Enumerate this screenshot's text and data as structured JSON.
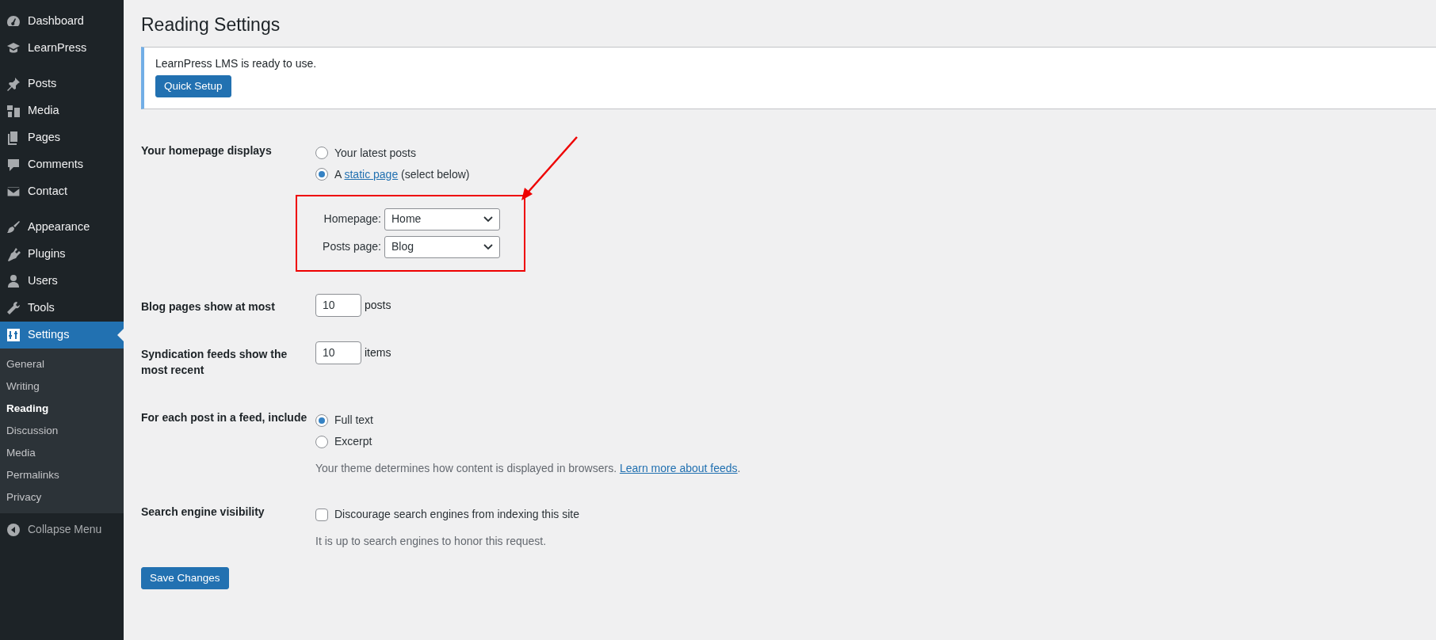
{
  "sidebar": {
    "groups": [
      [
        {
          "label": "Dashboard",
          "selected": false
        },
        {
          "label": "LearnPress",
          "selected": false
        }
      ],
      [
        {
          "label": "Posts",
          "selected": false
        },
        {
          "label": "Media",
          "selected": false
        },
        {
          "label": "Pages",
          "selected": false
        },
        {
          "label": "Comments",
          "selected": false
        },
        {
          "label": "Contact",
          "selected": false
        }
      ],
      [
        {
          "label": "Appearance",
          "selected": false
        },
        {
          "label": "Plugins",
          "selected": false
        },
        {
          "label": "Users",
          "selected": false
        },
        {
          "label": "Tools",
          "selected": false
        },
        {
          "label": "Settings",
          "selected": true,
          "children": [
            {
              "label": "General",
              "selected": false
            },
            {
              "label": "Writing",
              "selected": false
            },
            {
              "label": "Reading",
              "selected": true
            },
            {
              "label": "Discussion",
              "selected": false
            },
            {
              "label": "Media",
              "selected": false
            },
            {
              "label": "Permalinks",
              "selected": false
            },
            {
              "label": "Privacy",
              "selected": false
            }
          ]
        }
      ]
    ],
    "collapse_label": "Collapse Menu"
  },
  "title": "Reading Settings",
  "notice": {
    "text": "LearnPress LMS is ready to use.",
    "button": "Quick Setup"
  },
  "rows": [
    {
      "kind": "radio-group",
      "label": "Your homepage displays",
      "options": [
        {
          "before": "Your latest posts",
          "selected": false
        },
        {
          "before": "A ",
          "link": "static page",
          "after": " (select below)",
          "selected": true
        }
      ],
      "selects": [
        {
          "label": "Homepage:",
          "value": "Home"
        },
        {
          "label": "Posts page:",
          "value": "Blog"
        }
      ]
    },
    {
      "kind": "number",
      "label": "Blog pages show at most",
      "value": "10",
      "unit": "posts"
    },
    {
      "kind": "number",
      "label": "Syndication feeds show the most recent",
      "value": "10",
      "unit": "items"
    },
    {
      "kind": "radio-group",
      "label": "For each post in a feed, include",
      "options": [
        {
          "before": "Full text",
          "selected": true
        },
        {
          "before": "Excerpt",
          "selected": false
        }
      ],
      "description": {
        "before": "Your theme determines how content is displayed in browsers. ",
        "link": "Learn more about feeds",
        "after": "."
      }
    },
    {
      "kind": "checkbox",
      "label": "Search engine visibility",
      "text": "Discourage search engines from indexing this site",
      "checked": false,
      "description": {
        "before": "It is up to search engines to honor this request."
      }
    }
  ],
  "save_button": "Save Changes"
}
